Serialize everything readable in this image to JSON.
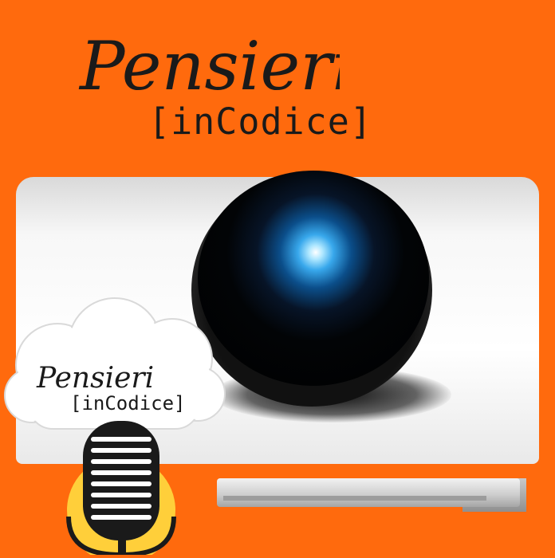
{
  "title": {
    "line1": "Pensieri",
    "line2": "[inCodice]"
  },
  "badge": {
    "line1": "Pensieri",
    "line2": "[inCodice]"
  },
  "colors": {
    "background": "#ff6a0d",
    "text": "#1a1a1a",
    "lens_glow": "#38a8ec",
    "mic_circle": "#ffcf3a"
  },
  "icons": [
    "webcam-icon",
    "cloud-icon",
    "microphone-icon"
  ]
}
